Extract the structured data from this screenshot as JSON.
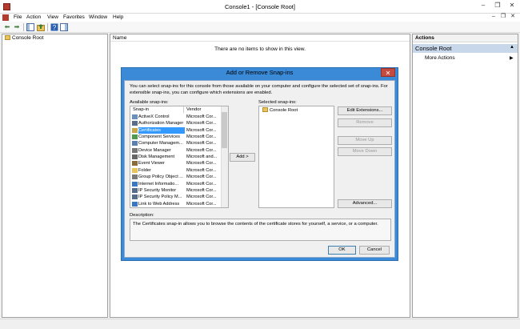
{
  "window": {
    "title": "Console1 - [Console Root]",
    "controls": [
      "–",
      "❐",
      "✕"
    ]
  },
  "menu": [
    "File",
    "Action",
    "View",
    "Favorites",
    "Window",
    "Help"
  ],
  "child_controls": [
    "–",
    "❐",
    "✕"
  ],
  "tree": {
    "root": "Console Root"
  },
  "list": {
    "column_name": "Name",
    "empty_message": "There are no items to show in this view."
  },
  "actions": {
    "header": "Actions",
    "section": "Console Root",
    "more": "More Actions"
  },
  "dialog": {
    "title": "Add or Remove Snap-ins",
    "close": "✕",
    "description": "You can select snap-ins for this console from those available on your computer and configure the selected set of snap-ins. For extensible snap-ins, you can configure which extensions are enabled.",
    "available_label": "Available snap-ins:",
    "selected_label": "Selected snap-ins:",
    "columns": {
      "snapin": "Snap-in",
      "vendor": "Vendor"
    },
    "available": [
      {
        "name": "ActiveX Control",
        "vendor": "Microsoft Cor...",
        "color": "#6b8fbf"
      },
      {
        "name": "Authorization Manager",
        "vendor": "Microsoft Cor...",
        "color": "#5a6e8c"
      },
      {
        "name": "Certificates",
        "vendor": "Microsoft Cor...",
        "color": "#c9a646",
        "selected": true
      },
      {
        "name": "Component Services",
        "vendor": "Microsoft Cor...",
        "color": "#4e9a4e"
      },
      {
        "name": "Computer Managem...",
        "vendor": "Microsoft Cor...",
        "color": "#5b7fb0"
      },
      {
        "name": "Device Manager",
        "vendor": "Microsoft Cor...",
        "color": "#777"
      },
      {
        "name": "Disk Management",
        "vendor": "Microsoft and...",
        "color": "#666"
      },
      {
        "name": "Event Viewer",
        "vendor": "Microsoft Cor...",
        "color": "#8a6d3b"
      },
      {
        "name": "Folder",
        "vendor": "Microsoft Cor...",
        "color": "#e8c45a"
      },
      {
        "name": "Group Policy Object ...",
        "vendor": "Microsoft Cor...",
        "color": "#7a7a7a"
      },
      {
        "name": "Internet Informatio...",
        "vendor": "Microsoft Cor...",
        "color": "#3b78c4"
      },
      {
        "name": "IP Security Monitor",
        "vendor": "Microsoft Cor...",
        "color": "#556b8a"
      },
      {
        "name": "IP Security Policy M...",
        "vendor": "Microsoft Cor...",
        "color": "#556b8a"
      },
      {
        "name": "Link to Web Address",
        "vendor": "Microsoft Cor...",
        "color": "#3b78c4"
      }
    ],
    "add_button": "Add >",
    "selected": [
      "Console Root"
    ],
    "buttons": {
      "edit_extensions": "Edit Extensions...",
      "remove": "Remove",
      "move_up": "Move Up",
      "move_down": "Move Down",
      "advanced": "Advanced..."
    },
    "description_label": "Description:",
    "description_text": "The Certificates snap-in allows you to browse the contents of the certificate stores for yourself, a service, or a computer.",
    "ok": "OK",
    "cancel": "Cancel"
  },
  "colors": {
    "dialog_frame": "#3a8ad8",
    "selection": "#3399ff",
    "close_red": "#c74a3e",
    "actions_section": "#c8d8ea"
  }
}
